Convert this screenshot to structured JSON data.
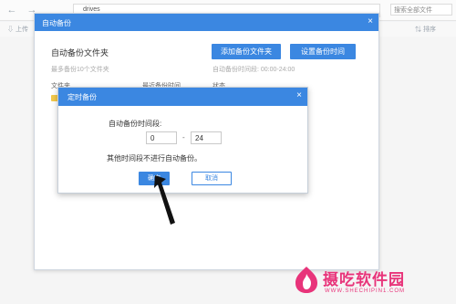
{
  "topbar": {
    "back_icon": "back-arrow-icon",
    "forward_icon": "forward-arrow-icon",
    "path": "drives",
    "search_placeholder": "搜索全部文件",
    "upload_label": "上传",
    "sort_label": "排序"
  },
  "backup_dialog": {
    "title": "自动备份",
    "section_title": "自动备份文件夹",
    "limit_text": "最多备份10个文件夹",
    "time_range_text": "自动备份时间段:  00:00-24:00",
    "add_folder_label": "添加备份文件夹",
    "set_time_label": "设置备份时间",
    "columns": [
      "文件夹",
      "最近备份时间",
      "状态"
    ]
  },
  "timer_dialog": {
    "title": "定时备份",
    "period_label": "自动备份时间段:",
    "start_value": "0",
    "separator": "-",
    "end_value": "24",
    "note": "其他时间段不进行自动备份。",
    "ok_label": "确定",
    "cancel_label": "取消"
  },
  "watermark": {
    "main": "摄吃软件园",
    "sub": "WWW.SHECHIPIN1.COM"
  },
  "colors": {
    "accent": "#3b87e1",
    "watermark": "#e8347a"
  }
}
